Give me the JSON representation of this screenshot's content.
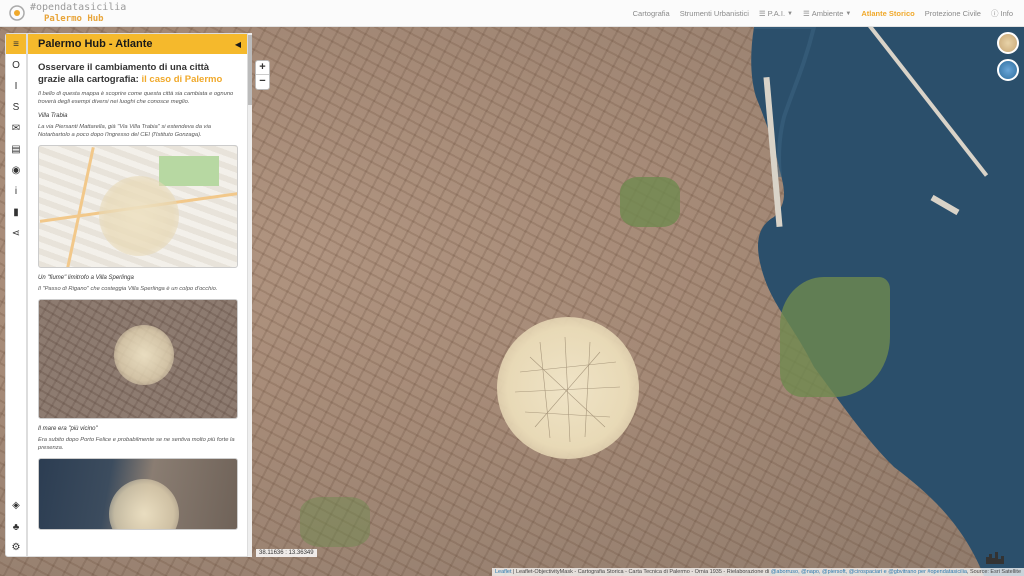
{
  "brand": {
    "hashtag": "#opendatasicilia",
    "name": "Palermo Hub"
  },
  "nav": {
    "items": [
      {
        "label": "Cartografia"
      },
      {
        "label": "Strumenti Urbanistici"
      },
      {
        "label": "P.A.I."
      },
      {
        "label": "Ambiente"
      },
      {
        "label": "Atlante Storico"
      },
      {
        "label": "Protezione Civile"
      },
      {
        "label": "Info"
      }
    ],
    "active": "Atlante Storico"
  },
  "rail": {
    "items": [
      {
        "icon": "menu-icon",
        "glyph": "≡"
      },
      {
        "icon": "letter-o-icon",
        "glyph": "O"
      },
      {
        "icon": "letter-i-icon",
        "glyph": "I"
      },
      {
        "icon": "letter-s-icon",
        "glyph": "S"
      },
      {
        "icon": "envelope-icon",
        "glyph": "✉"
      },
      {
        "icon": "book-icon",
        "glyph": "▤"
      },
      {
        "icon": "github-icon",
        "glyph": "◉"
      },
      {
        "icon": "info-icon",
        "glyph": "i"
      },
      {
        "icon": "bookmark-icon",
        "glyph": "▮"
      },
      {
        "icon": "share-icon",
        "glyph": "⋖"
      },
      {
        "icon": "layers-icon",
        "glyph": "◈"
      },
      {
        "icon": "plant-icon",
        "glyph": "♣"
      },
      {
        "icon": "gear-icon",
        "glyph": "⚙"
      }
    ]
  },
  "panel": {
    "title": "Palermo Hub - Atlante",
    "collapse_glyph": "◀",
    "intro_title": "Osservare il cambiamento di una città grazie alla cartografia:",
    "intro_highlight": "il caso di Palermo",
    "intro_text": "Il bello di questa mappa è scoprire come questa città sia cambiata e ognuno troverà degli esempi diversi nei luoghi che conosce meglio.",
    "sections": [
      {
        "heading": "Villa Trabia",
        "text": "La via Piersanti Mattarella, già \"Via Villa Trabia\" si estendeva da via Notarbartolo a poco dopo l'ingresso del CEI (l'Istituto Gonzaga)."
      },
      {
        "heading": "Un \"fiume\" limitrofo a Villa Sperlinga",
        "text": "Il \"Passo di Rigano\" che costeggia Villa Sperlinga è un colpo d'occhio."
      },
      {
        "heading": "Il mare era \"più vicino\"",
        "text": "Era subito dopo Porto Felice e probabilmente se ne sentiva molto più forte la presenza."
      }
    ]
  },
  "map": {
    "zoom_in": "+",
    "zoom_out": "−",
    "coords": "38.11636 : 13.36349",
    "attribution_prefix": "Leaflet",
    "attribution_mid": " | Leaflet-ObjectivityMask - Cartografia Storica - Carta Tecnica di Palermo - Ornia 1935 - Rielaborazione di ",
    "attribution_credits": "@aborruso, @napo, @piersoft, @cirospaciari e @gbvitrano per #opendatasicilia",
    "attribution_source": ", Source: Esri Satellite"
  },
  "colors": {
    "accent": "#f5b92c",
    "accent_text": "#f0a92b",
    "sea": "#2b4f6b"
  }
}
